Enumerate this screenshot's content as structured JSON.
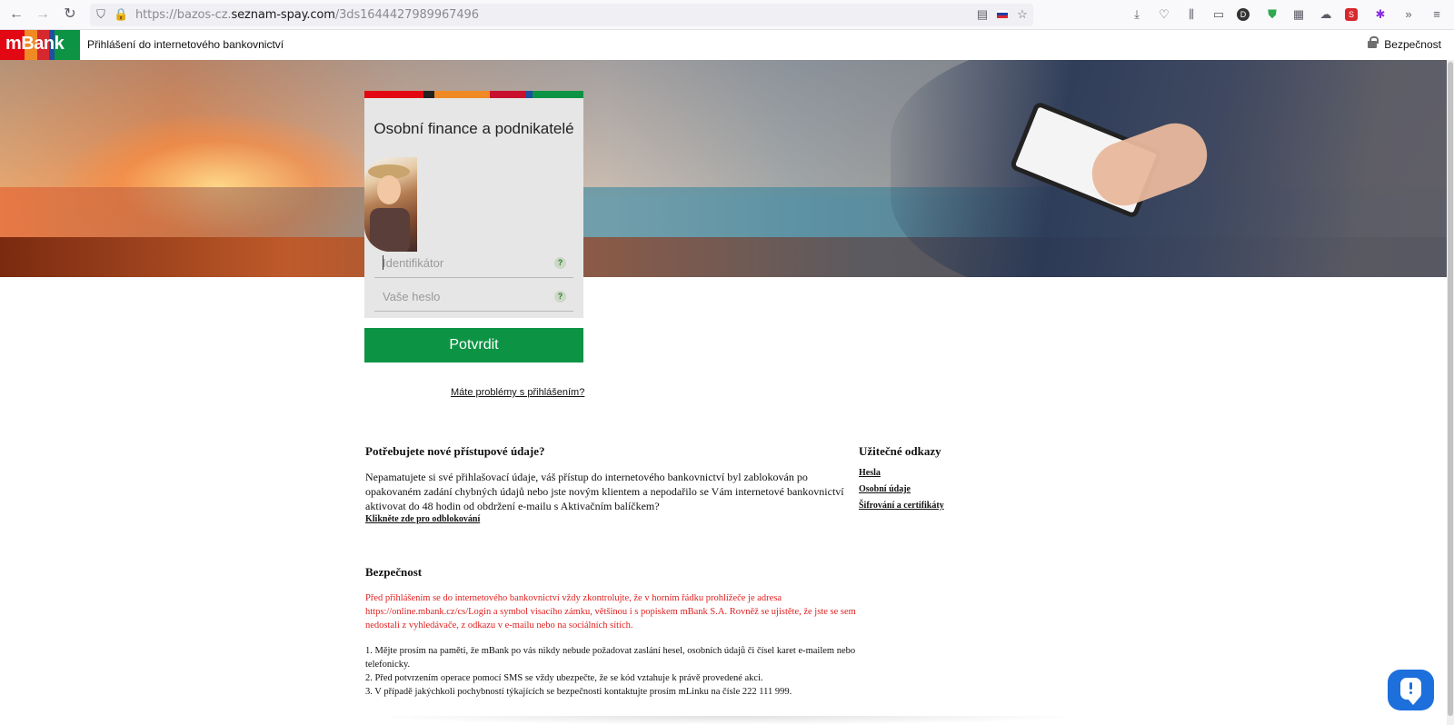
{
  "browser": {
    "url_prefix": "https://bazos-cz.",
    "url_host": "seznam-spay.com",
    "url_path": "/3ds1644427989967496"
  },
  "header": {
    "logo": "mBank",
    "title": "Přihlášení do internetového bankovnictví",
    "security": "Bezpečnost"
  },
  "login": {
    "title": "Osobní finance a podnikatelé",
    "identifier_placeholder": "Identifikátor",
    "password_placeholder": "Vaše heslo",
    "help": "?",
    "submit": "Potvrdit",
    "problem": "Máte problémy s přihlášením?"
  },
  "access": {
    "title": "Potřebujete nové přístupové údaje?",
    "text": "Nepamatujete si své přihlašovací údaje, váš přístup do internetového bankovnictví byl zablokován po opakovaném zadání chybných údajů nebo jste novým klientem a nepodařilo se Vám internetové bankovnictví aktivovat do 48 hodin od obdržení e-mailu s Aktivačním balíčkem?",
    "link": "Klikněte zde pro odblokování"
  },
  "useful": {
    "title": "Užitečné odkazy",
    "links": [
      "Hesla",
      "Osobní údaje",
      "Šifrování a certifikáty"
    ]
  },
  "security": {
    "title": "Bezpečnost",
    "warning": "Před přihlášením se do internetového bankovnictví vždy zkontrolujte, že v horním řádku prohlížeče je adresa https://online.mbank.cz/cs/Login a symbol visacího zámku, většinou i s popiskem mBank S.A. Rovněž se ujistěte, že jste se sem nedostali z vyhledávače, z odkazu v e-mailu nebo na sociálních sítích.",
    "notes": [
      "1. Mějte prosím na paměti, že mBank po vás nikdy nebude požadovat zaslání hesel, osobních údajů či čísel karet e-mailem nebo telefonicky.",
      "2. Před potvrzením operace pomocí SMS se vždy ubezpečte, že se kód vztahuje k právě provedené akci.",
      "3. V případě jakýchkoli pochybností týkajících se bezpečnosti kontaktujte prosím mLinku na čísle 222 111 999."
    ]
  },
  "colors": {
    "brand_green": "#0c9444",
    "warning_red": "#e0201f",
    "strip": [
      "#e30613",
      "#222222",
      "#f08a24",
      "#c8102e",
      "#1d4fa3",
      "#0c9444"
    ]
  },
  "icons": [
    "back-icon",
    "forward-icon",
    "reload-icon",
    "shield-icon",
    "lock-icon",
    "reader-icon",
    "flag-icon",
    "star-icon",
    "download-icon",
    "pocket-icon",
    "library-icon",
    "sidebar-icon",
    "menu-icon",
    "chat-icon"
  ]
}
